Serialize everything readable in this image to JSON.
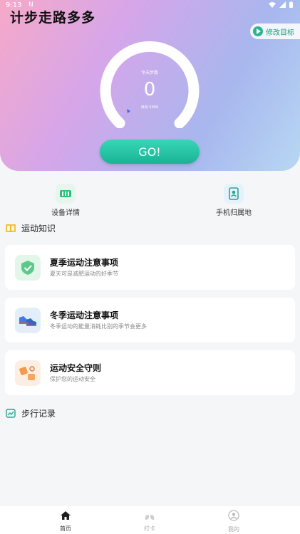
{
  "status_bar": {
    "time": "9:13",
    "small_text": "N"
  },
  "header": {
    "title": "计步走路多多",
    "goal_button": "修改目标"
  },
  "gauge": {
    "caption": "今天步数",
    "steps": "0",
    "target": "目标 5000",
    "progress": 0
  },
  "go_button": "GO!",
  "quick_actions": [
    {
      "label": "设备详情",
      "icon": "device-icon"
    },
    {
      "label": "手机归属地",
      "icon": "phone-location-icon"
    }
  ],
  "knowledge": {
    "title": "运动知识",
    "items": [
      {
        "title": "夏季运动注意事项",
        "desc": "夏天可是减肥运动的好季节",
        "icon": "shield-check-icon"
      },
      {
        "title": "冬季运动注意事项",
        "desc": "冬季运动的能量消耗比别的季节会更多",
        "icon": "sneakers-icon"
      },
      {
        "title": "运动安全守则",
        "desc": "保护您的运动安全",
        "icon": "safety-icon"
      }
    ]
  },
  "records": {
    "title": "步行记录"
  },
  "tabbar": [
    {
      "label": "首页",
      "icon": "home-icon",
      "active": true
    },
    {
      "label": "打卡",
      "icon": "lungs-icon",
      "active": false
    },
    {
      "label": "我的",
      "icon": "profile-icon",
      "active": false
    }
  ],
  "colors": {
    "accent": "#1ab395",
    "goal_text": "#1e9b78"
  }
}
